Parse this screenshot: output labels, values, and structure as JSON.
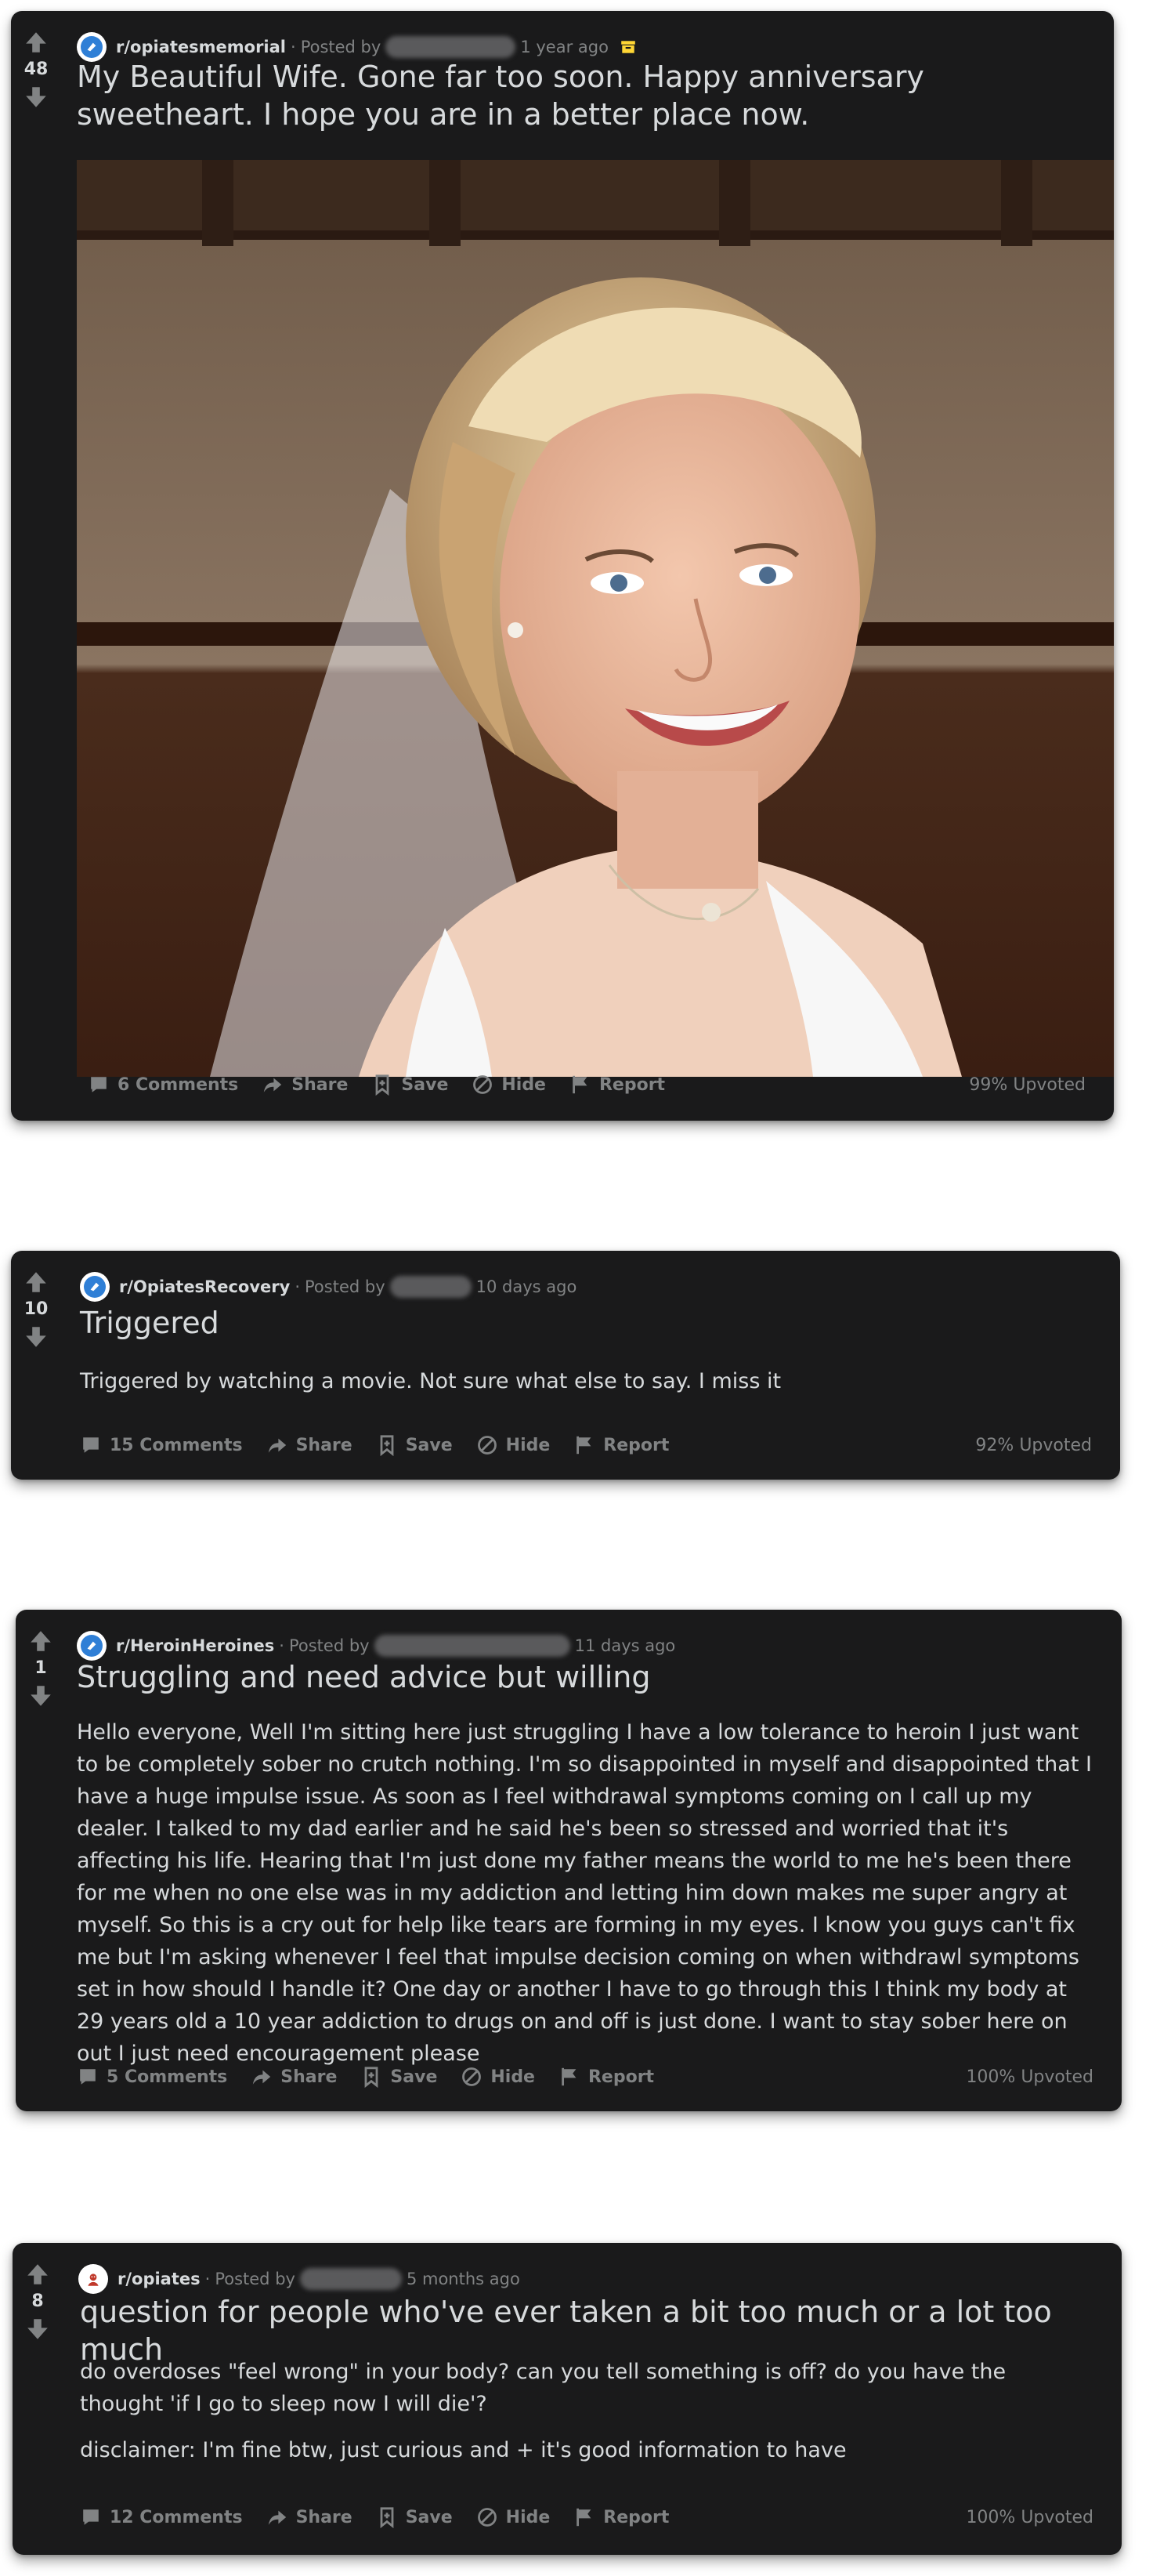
{
  "posts": [
    {
      "subreddit": "r/opiatesmemorial",
      "posted_by_label": "Posted by",
      "age": "1 year ago",
      "score": "48",
      "title": "My Beautiful Wife. Gone far too soon. Happy anniversary sweetheart. I hope you are in a better place now.",
      "image_icon": "photo-bride-portrait",
      "archived_icon": "archive-icon",
      "actions": {
        "comments": "6 Comments",
        "share": "Share",
        "save": "Save",
        "hide": "Hide",
        "report": "Report"
      },
      "upvoted": "99% Upvoted"
    },
    {
      "subreddit": "r/OpiatesRecovery",
      "posted_by_label": "Posted by",
      "age": "10 days ago",
      "score": "10",
      "title": "Triggered",
      "body": [
        "Triggered by watching a movie. Not sure what else to say. I miss it"
      ],
      "actions": {
        "comments": "15 Comments",
        "share": "Share",
        "save": "Save",
        "hide": "Hide",
        "report": "Report"
      },
      "upvoted": "92% Upvoted"
    },
    {
      "subreddit": "r/HeroinHeroines",
      "posted_by_label": "Posted by",
      "age": "11 days ago",
      "score": "1",
      "title": "Struggling and need advice but willing",
      "body": [
        "Hello everyone, Well I'm sitting here just struggling I have a low tolerance to heroin I just want to be completely sober no crutch nothing. I'm so disappointed in myself and disappointed that I have a huge impulse issue. As soon as I feel withdrawal symptoms coming on I call up my dealer. I talked to my dad earlier and he said he's been so stressed and worried that it's affecting his life. Hearing that I'm just done my father means the world to me he's been there for me when no one else was in my addiction and letting him down makes me super angry at myself. So this is a cry out for help like tears are forming in my eyes. I know you guys can't fix me but I'm asking whenever I feel that impulse decision coming on when withdrawl symptoms set in how should I handle it? One day or another I have to go through this I think my body at 29 years old a 10 year addiction to drugs on and off is just done. I want to stay sober here on out I just need encouragement please"
      ],
      "actions": {
        "comments": "5 Comments",
        "share": "Share",
        "save": "Save",
        "hide": "Hide",
        "report": "Report"
      },
      "upvoted": "100% Upvoted"
    },
    {
      "subreddit": "r/opiates",
      "posted_by_label": "Posted by",
      "age": "5 months ago",
      "score": "8",
      "title": "question for people who've ever taken a bit too much or a lot too much",
      "body": [
        "do overdoses \"feel wrong\" in your body? can you tell something is off? do you have the thought 'if I go to sleep now I will die'?",
        "disclaimer: I'm fine btw, just curious and + it's good information to have"
      ],
      "actions": {
        "comments": "12 Comments",
        "share": "Share",
        "save": "Save",
        "hide": "Hide",
        "report": "Report"
      },
      "upvoted": "100% Upvoted"
    }
  ],
  "colors": {
    "card_bg": "#1a1a1b",
    "text": "#d7dadc",
    "muted": "#818384",
    "subreddit_icon": "#2f7fd6",
    "archive_badge": "#ffd635"
  }
}
